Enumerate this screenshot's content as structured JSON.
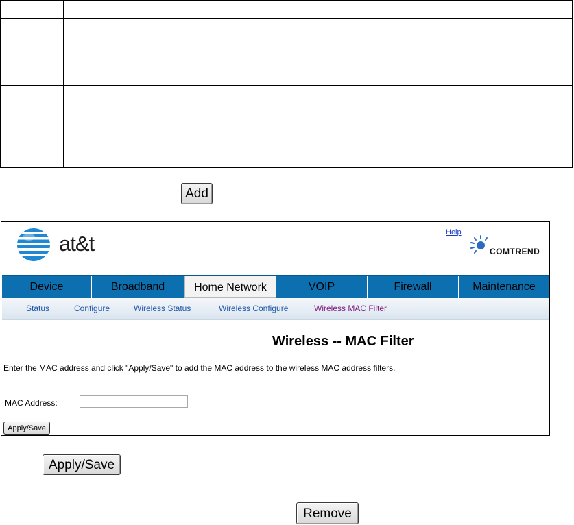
{
  "buttons": {
    "add_label": "Add",
    "apply_save_label": "Apply/Save",
    "remove_label": "Remove"
  },
  "router": {
    "brand_text": "at&t",
    "help_label": "Help",
    "vendor_text": "COMTREND",
    "nav": [
      "Device",
      "Broadband",
      "Home Network",
      "VOIP",
      "Firewall",
      "Maintenance"
    ],
    "active_nav": "Home Network",
    "subnav": [
      "Status",
      "Configure",
      "Wireless Status",
      "Wireless Configure",
      "Wireless MAC Filter"
    ],
    "active_subnav": "Wireless MAC Filter",
    "heading": "Wireless -- MAC Filter",
    "instructions": "Enter the MAC address and click \"Apply/Save\" to add the MAC address to the wireless MAC address filters.",
    "mac_label": "MAC Address:",
    "mac_value": "",
    "apply_label": "Apply/Save"
  },
  "colors": {
    "nav_blue": "#0c6fb0",
    "link_blue": "#1d56a8",
    "active_sub": "#7a1a7a"
  }
}
